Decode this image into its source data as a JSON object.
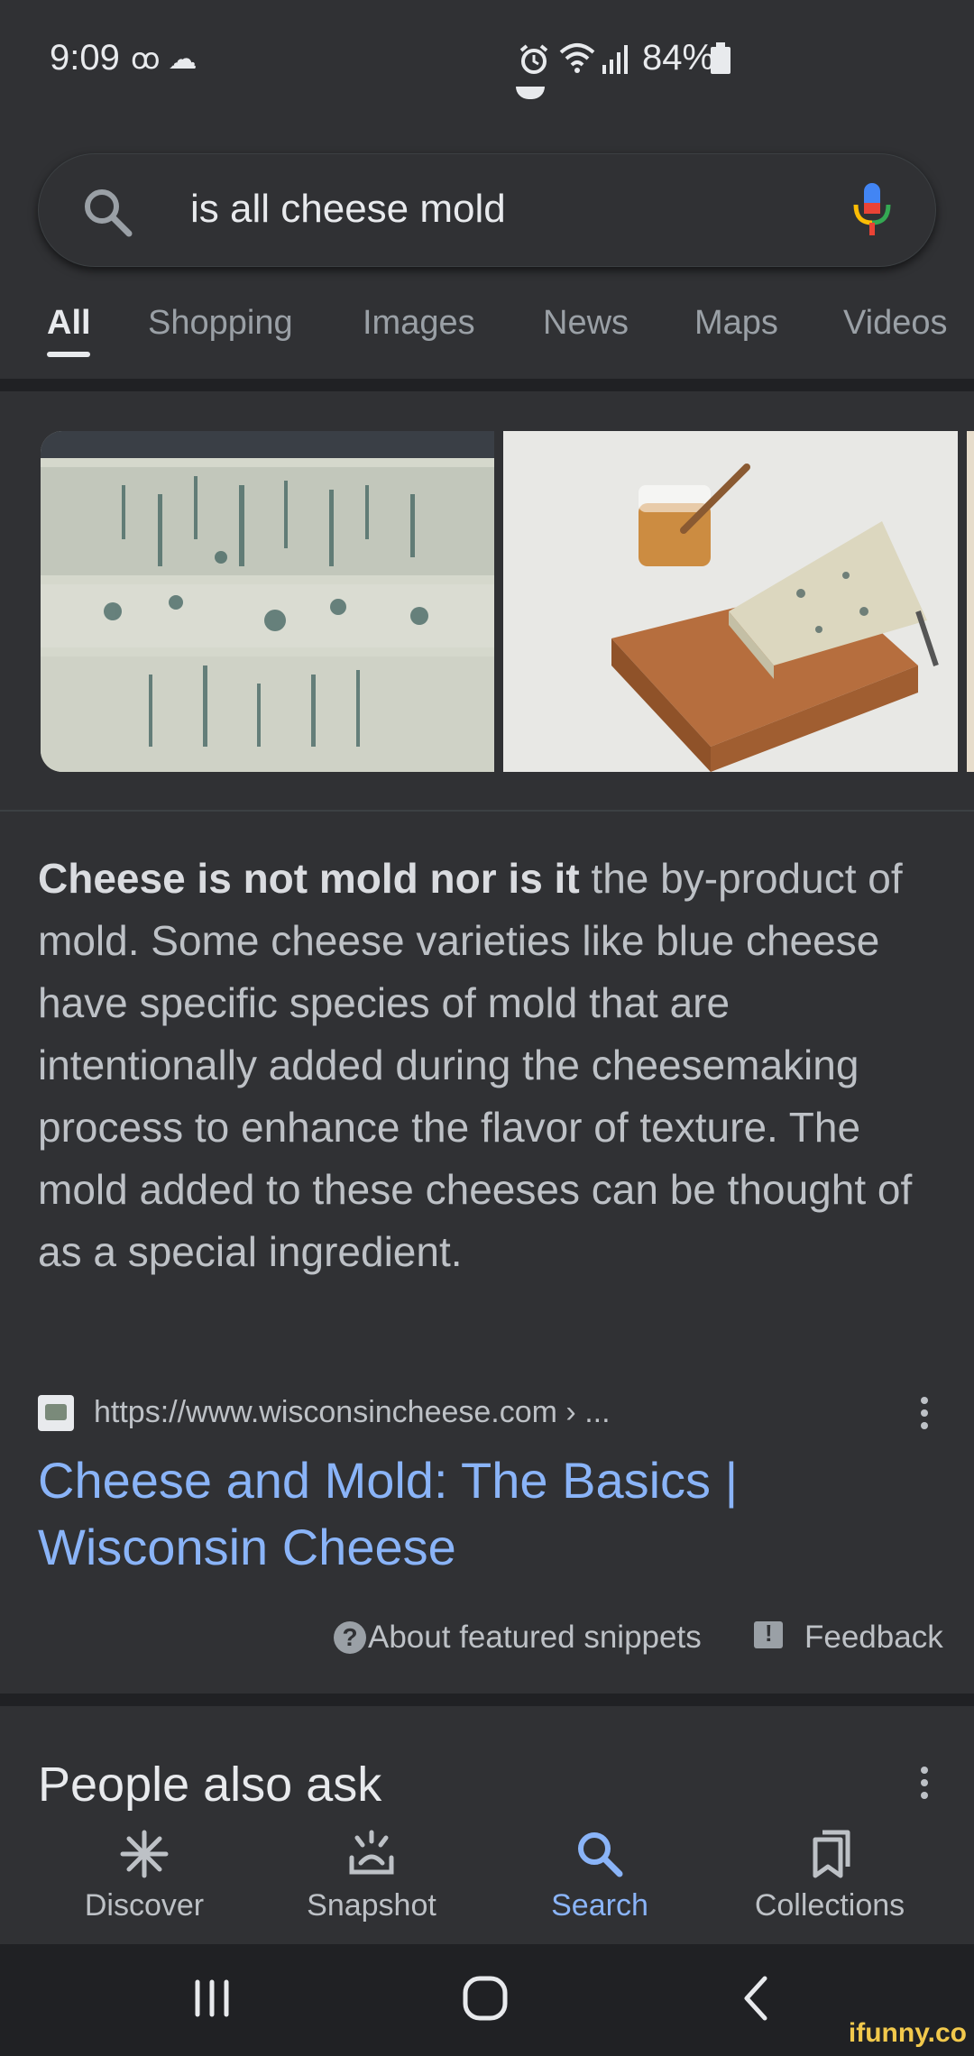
{
  "status_bar": {
    "time": "9:09",
    "left_icons": "ꝏ ☁",
    "battery": "84%",
    "right_icons": "⏰ 📶 .ıll"
  },
  "search": {
    "query": "is all cheese mold"
  },
  "tabs": [
    "All",
    "Shopping",
    "Images",
    "News",
    "Maps",
    "Videos"
  ],
  "snippet": {
    "bold": "Cheese is not mold nor is it",
    "text": " the by-product of mold. Some cheese varieties like blue cheese have specific species of mold that are intentionally added during the cheesemaking process to enhance the flavor of texture. The mold added to these cheeses can be thought of as a special ingredient."
  },
  "source": {
    "url": "https://www.wisconsincheese.com › ...",
    "title": "Cheese and Mold: The Basics | Wisconsin Cheese"
  },
  "meta": {
    "about": "About featured snippets",
    "feedback": "Feedback"
  },
  "people_also_ask": {
    "title": "People also ask"
  },
  "bottom_nav": {
    "discover": "Discover",
    "snapshot": "Snapshot",
    "search": "Search",
    "collections": "Collections"
  },
  "watermark": "ifunny.co",
  "colors": {
    "background": "#303134",
    "link": "#8ab4f8",
    "text": "#bdc1c6",
    "divider": "#202124"
  }
}
